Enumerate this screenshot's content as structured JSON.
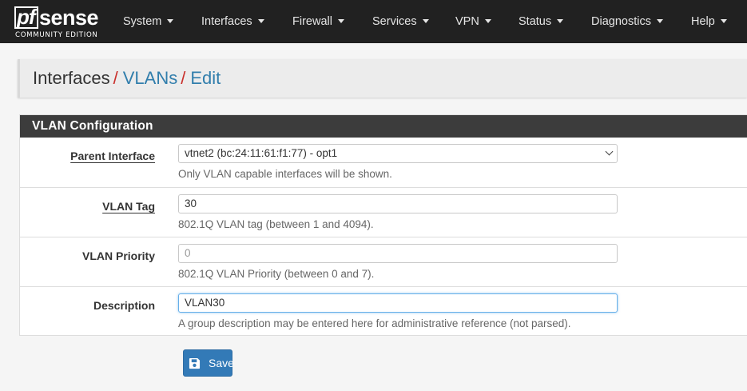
{
  "brand": {
    "sub": "COMMUNITY EDITION",
    "logo_pf": "pf",
    "logo_sense": "sense"
  },
  "nav": {
    "items": [
      {
        "label": "System"
      },
      {
        "label": "Interfaces"
      },
      {
        "label": "Firewall"
      },
      {
        "label": "Services"
      },
      {
        "label": "VPN"
      },
      {
        "label": "Status"
      },
      {
        "label": "Diagnostics"
      },
      {
        "label": "Help"
      }
    ]
  },
  "breadcrumb": {
    "root": "Interfaces",
    "section": "VLANs",
    "current": "Edit",
    "separator": "/"
  },
  "panel": {
    "title": "VLAN Configuration"
  },
  "form": {
    "parent_interface": {
      "label": "Parent Interface",
      "value": "vtnet2 (bc:24:11:61:f1:77) - opt1",
      "help": "Only VLAN capable interfaces will be shown."
    },
    "vlan_tag": {
      "label": "VLAN Tag",
      "value": "30",
      "help": "802.1Q VLAN tag (between 1 and 4094)."
    },
    "vlan_priority": {
      "label": "VLAN Priority",
      "placeholder": "0",
      "help": "802.1Q VLAN Priority (between 0 and 7)."
    },
    "description": {
      "label": "Description",
      "value": "VLAN30",
      "help": "A group description may be entered here for administrative reference (not parsed)."
    }
  },
  "save_button": {
    "label": "Save",
    "icon": "floppy-disk-icon"
  },
  "colors": {
    "navbar": "#212121",
    "link": "#317eac",
    "separator": "#c9302c",
    "panel_head": "#3c3c3c",
    "primary": "#337ab7"
  }
}
